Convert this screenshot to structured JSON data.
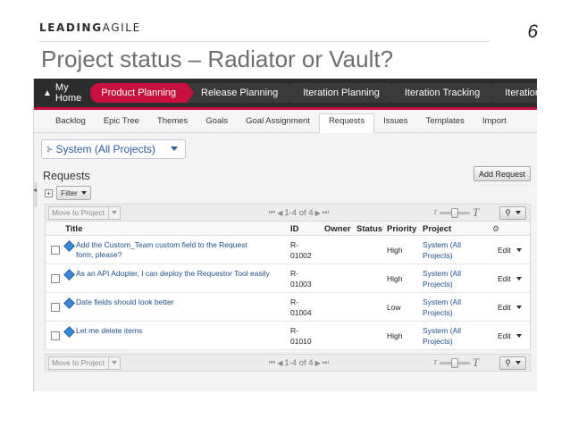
{
  "slide": {
    "logo_bold": "LEADING",
    "logo_light": "AGILE",
    "number": "6",
    "title": "Project status – Radiator or Vault?"
  },
  "topnav": {
    "home": "My Home",
    "tabs": [
      "Product Planning",
      "Release Planning",
      "Iteration Planning",
      "Iteration Tracking",
      "Iteration"
    ],
    "active_tab": "Product Planning"
  },
  "subnav": {
    "tabs": [
      "Backlog",
      "Epic Tree",
      "Themes",
      "Goals",
      "Goal Assignment",
      "Requests",
      "Issues",
      "Templates",
      "Import"
    ],
    "active": "Requests"
  },
  "project_picker": {
    "value": "System (All Projects)"
  },
  "panel": {
    "title": "Requests",
    "add_button": "Add Request",
    "filter_label": "Filter",
    "move_to_project": "Move to Project",
    "pager": "1-4 of 4"
  },
  "table": {
    "columns": [
      "Title",
      "ID",
      "Owner",
      "Status",
      "Priority",
      "Project"
    ],
    "rows": [
      {
        "title": "Add the Custom_Team custom field to the Request form, please?",
        "id_line1": "R-",
        "id_line2": "01002",
        "priority": "High",
        "project_line1": "System (All",
        "project_line2": "Projects)",
        "action": "Edit"
      },
      {
        "title": "As an API Adopter, I can deploy the Requestor Tool easily",
        "id_line1": "R-",
        "id_line2": "01003",
        "priority": "High",
        "project_line1": "System (All",
        "project_line2": "Projects)",
        "action": "Edit"
      },
      {
        "title": "Date fields should look better",
        "id_line1": "R-",
        "id_line2": "01004",
        "priority": "Low",
        "project_line1": "System (All",
        "project_line2": "Projects)",
        "action": "Edit"
      },
      {
        "title": "Let me delete items",
        "id_line1": "R-",
        "id_line2": "01010",
        "priority": "High",
        "project_line1": "System (All",
        "project_line2": "Projects)",
        "action": "Edit"
      }
    ]
  },
  "colors": {
    "accent": "#c8103e",
    "nav_bg": "#2c2c2c",
    "link": "#1f4f8f"
  },
  "icons": {
    "home": "home-icon",
    "tree": "tree-icon",
    "request": "request-icon",
    "gear": "gear-icon",
    "search": "search-icon"
  }
}
